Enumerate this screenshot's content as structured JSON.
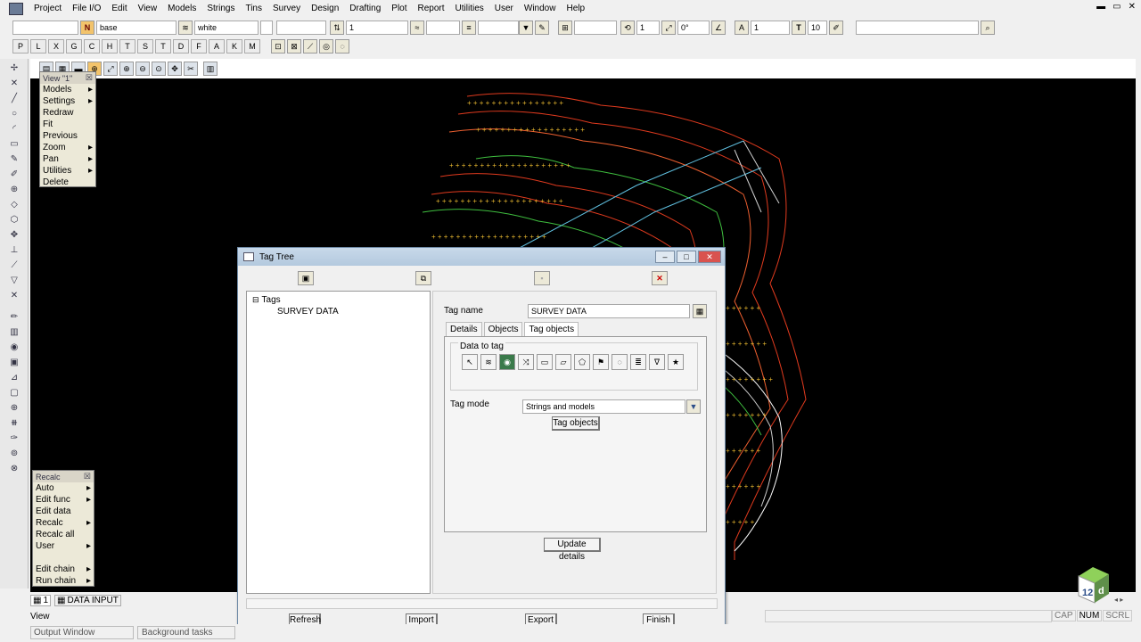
{
  "menu": [
    "Project",
    "File I/O",
    "Edit",
    "View",
    "Models",
    "Strings",
    "Tins",
    "Survey",
    "Design",
    "Drafting",
    "Plot",
    "Report",
    "Utilities",
    "User",
    "Window",
    "Help"
  ],
  "window_controls": [
    "▬",
    "▭",
    "✕"
  ],
  "toolbar1": {
    "model_label": "N",
    "model_value": "base",
    "colour_value": "white",
    "weight_value": "1",
    "number1": "1",
    "angle": "0°",
    "text_size": "1",
    "text_value": "10"
  },
  "letter_buttons": [
    "P",
    "L",
    "X",
    "G",
    "C",
    "H",
    "T",
    "S",
    "T",
    "D",
    "F",
    "A",
    "K",
    "M"
  ],
  "view_menu": {
    "title": "View \"1\"",
    "items": [
      {
        "label": "Models",
        "sub": true
      },
      {
        "label": "Settings",
        "sub": true
      },
      {
        "label": "Redraw",
        "sub": false
      },
      {
        "label": "Fit",
        "sub": false
      },
      {
        "label": "Previous",
        "sub": false
      },
      {
        "label": "Zoom",
        "sub": true
      },
      {
        "label": "Pan",
        "sub": true
      },
      {
        "label": "Utilities",
        "sub": true
      },
      {
        "label": "Delete",
        "sub": false
      }
    ]
  },
  "recalc_menu": {
    "title": "Recalc",
    "items": [
      {
        "label": "Auto",
        "sub": true
      },
      {
        "label": "Edit func",
        "sub": true
      },
      {
        "label": "Edit data",
        "sub": false
      },
      {
        "label": "Recalc",
        "sub": true
      },
      {
        "label": "Recalc all",
        "sub": false
      },
      {
        "label": "User",
        "sub": true
      },
      {
        "label": "",
        "sub": false
      },
      {
        "label": "Edit chain",
        "sub": true
      },
      {
        "label": "Run chain",
        "sub": true
      }
    ]
  },
  "dialog": {
    "title": "Tag Tree",
    "tree_root": "Tags",
    "tree_child": "SURVEY DATA",
    "tag_name_label": "Tag name",
    "tag_name_value": "SURVEY DATA",
    "tabs": [
      "Details",
      "Objects",
      "Tag objects"
    ],
    "active_tab": "Tag objects",
    "data_to_tag_label": "Data to tag",
    "tag_mode_label": "Tag mode",
    "tag_mode_value": "Strings and models",
    "tag_objects_button": "Tag objects",
    "update_details_button": "Update details",
    "footer_buttons": [
      "Refresh",
      "Import",
      "Export",
      "Finish"
    ]
  },
  "bottom_tabs": {
    "view_num": "1",
    "data_input": "DATA INPUT"
  },
  "view_label": "View",
  "output_window": "Output Window",
  "background_tasks": "Background tasks",
  "indicators": [
    "CAP",
    "NUM",
    "SCRL"
  ],
  "logo": "12d"
}
